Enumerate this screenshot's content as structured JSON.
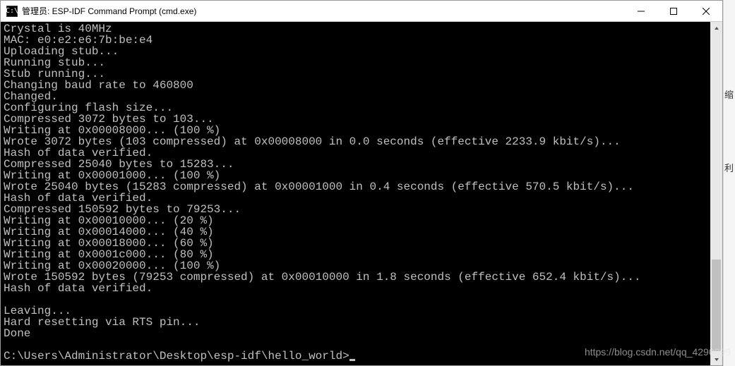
{
  "window": {
    "title": "管理员: ESP-IDF Command Prompt (cmd.exe)",
    "icon_label": "C:\\"
  },
  "terminal": {
    "lines": [
      "Crystal is 40MHz",
      "MAC: e0:e2:e6:7b:be:e4",
      "Uploading stub...",
      "Running stub...",
      "Stub running...",
      "Changing baud rate to 460800",
      "Changed.",
      "Configuring flash size...",
      "Compressed 3072 bytes to 103...",
      "Writing at 0x00008000... (100 %)",
      "Wrote 3072 bytes (103 compressed) at 0x00008000 in 0.0 seconds (effective 2233.9 kbit/s)...",
      "Hash of data verified.",
      "Compressed 25040 bytes to 15283...",
      "Writing at 0x00001000... (100 %)",
      "Wrote 25040 bytes (15283 compressed) at 0x00001000 in 0.4 seconds (effective 570.5 kbit/s)...",
      "Hash of data verified.",
      "Compressed 150592 bytes to 79253...",
      "Writing at 0x00010000... (20 %)",
      "Writing at 0x00014000... (40 %)",
      "Writing at 0x00018000... (60 %)",
      "Writing at 0x0001c000... (80 %)",
      "Writing at 0x00020000... (100 %)",
      "Wrote 150592 bytes (79253 compressed) at 0x00010000 in 1.8 seconds (effective 652.4 kbit/s)...",
      "Hash of data verified.",
      "",
      "Leaving...",
      "Hard resetting via RTS pin...",
      "Done",
      ""
    ],
    "prompt": "C:\\Users\\Administrator\\Desktop\\esp-idf\\hello_world>"
  },
  "watermark": "https://blog.csdn.net/qq_4290099",
  "side_chars": {
    "c1": "缩",
    "c2": "利"
  }
}
